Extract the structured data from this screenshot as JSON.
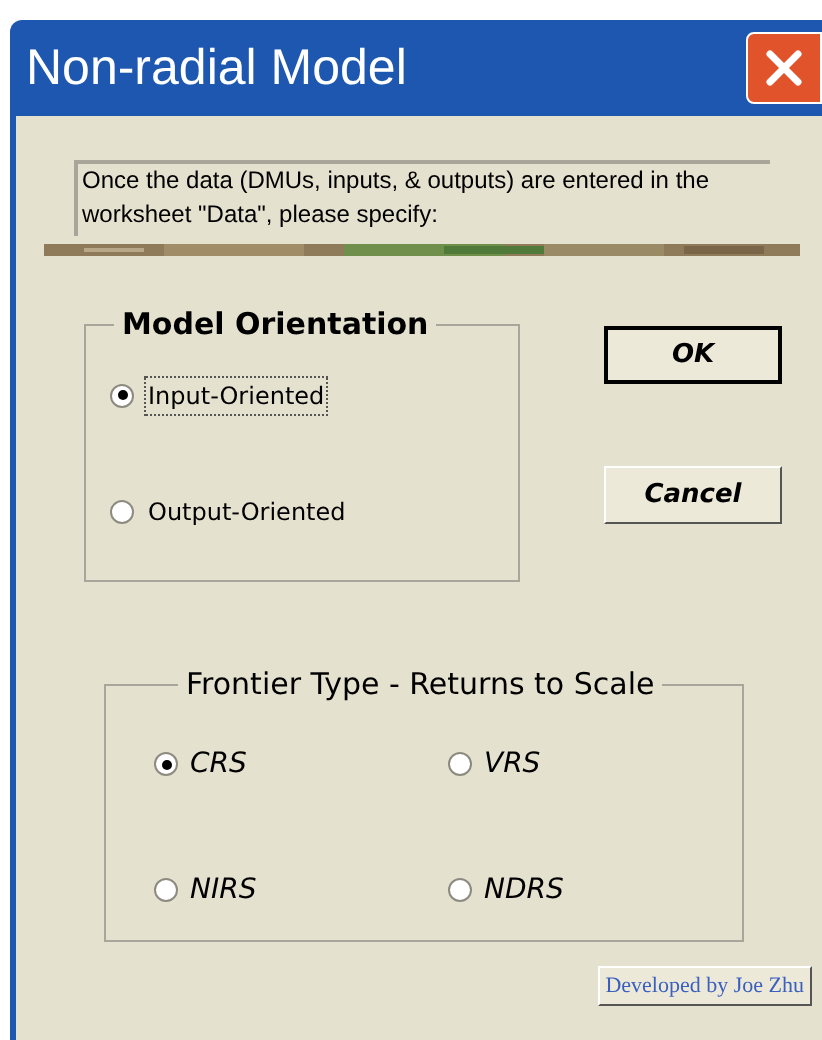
{
  "window": {
    "title": "Non-radial Model"
  },
  "instructions": "Once the data (DMUs, inputs, & outputs) are entered in the worksheet \"Data\", please specify:",
  "model_orientation": {
    "title": "Model Orientation",
    "options": [
      {
        "label": "Input-Oriented",
        "selected": true,
        "focused": true
      },
      {
        "label": "Output-Oriented",
        "selected": false,
        "focused": false
      }
    ]
  },
  "buttons": [
    {
      "label": "OK",
      "default": true
    },
    {
      "label": "Cancel",
      "default": false
    }
  ],
  "frontier_type": {
    "title": "Frontier Type - Returns to Scale",
    "options": [
      {
        "label": "CRS",
        "selected": true
      },
      {
        "label": "VRS",
        "selected": false
      },
      {
        "label": "NIRS",
        "selected": false
      },
      {
        "label": "NDRS",
        "selected": false
      }
    ]
  },
  "credit_button": {
    "label": "Developed by Joe Zhu"
  }
}
